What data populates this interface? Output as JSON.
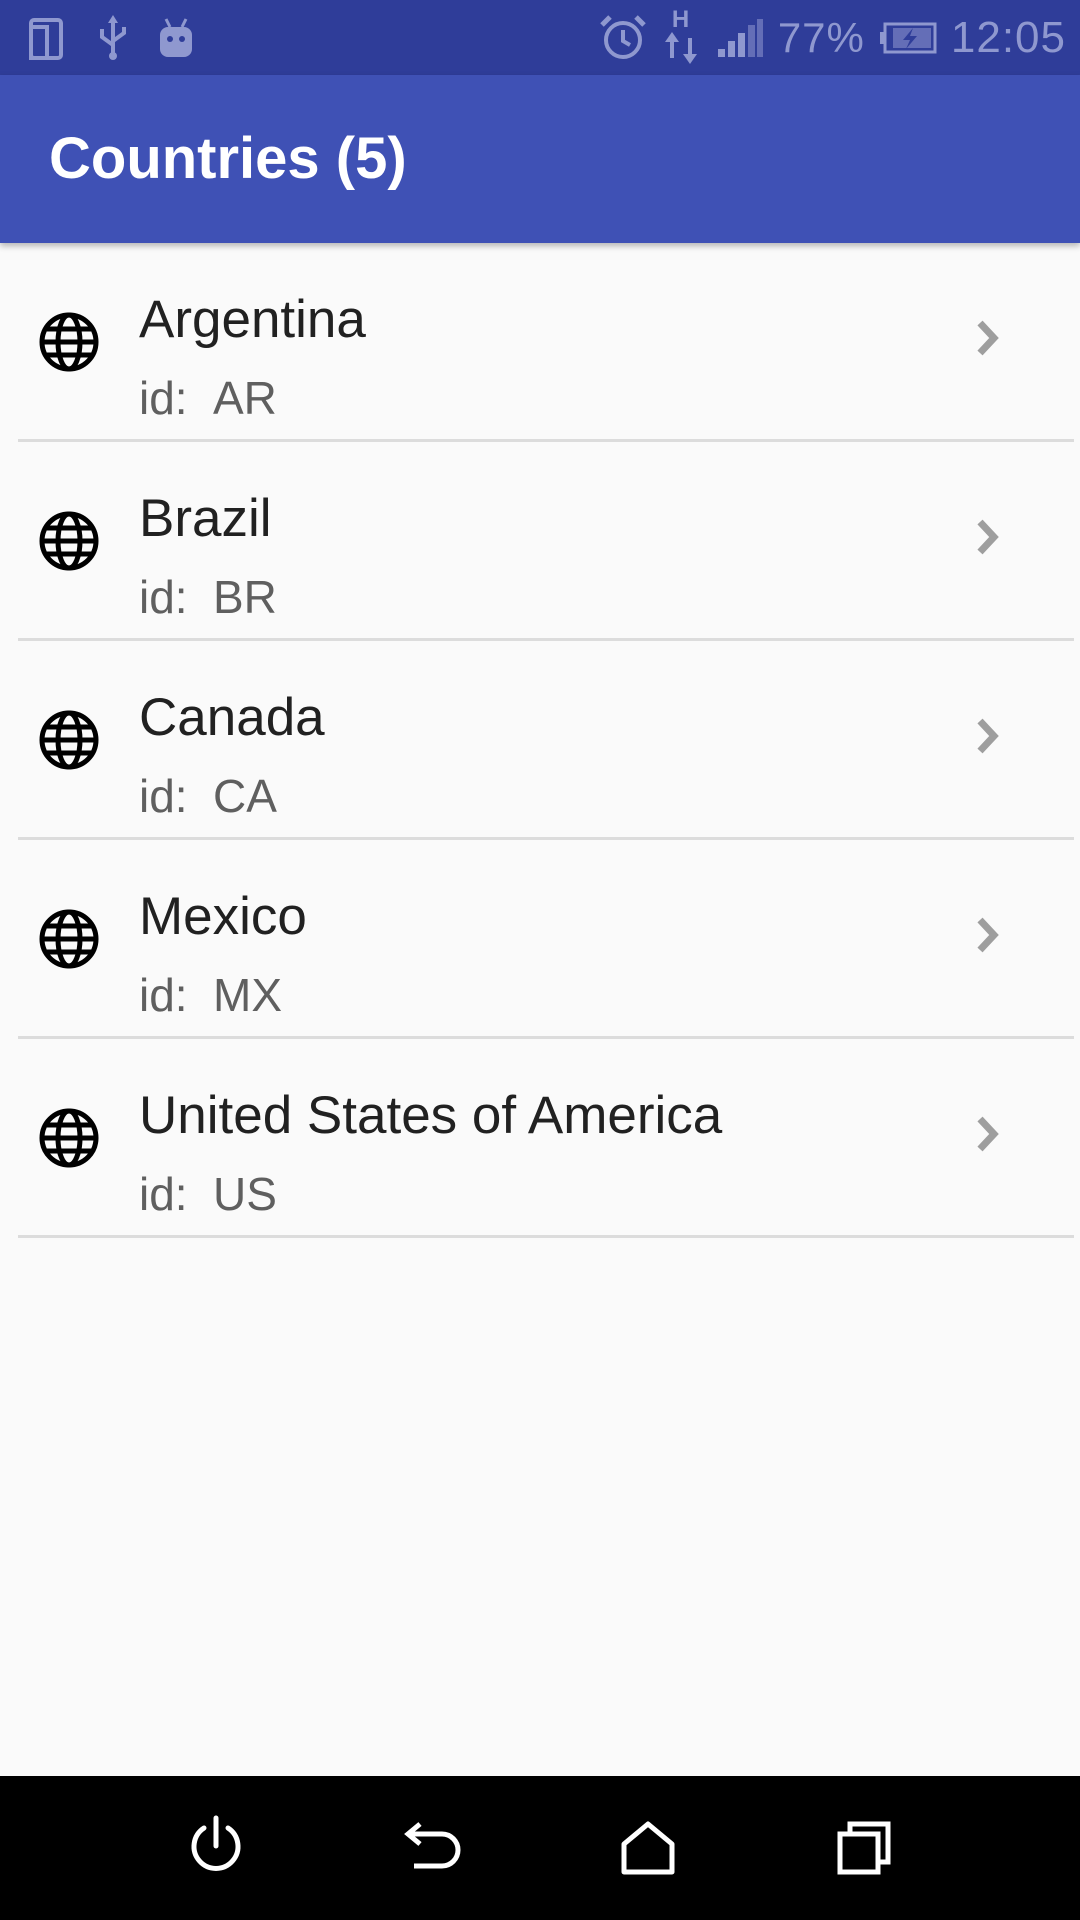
{
  "status_bar": {
    "battery": "77%",
    "time": "12:05",
    "network_type": "H",
    "icons_left": [
      "device-icon",
      "usb-icon",
      "android-debug-icon"
    ],
    "icons_right": [
      "alarm-icon",
      "data-transfer-icon",
      "signal-icon",
      "battery-charging-icon"
    ]
  },
  "app_bar": {
    "title": "Countries (5)"
  },
  "countries": [
    {
      "name": "Argentina",
      "id_label": "id:",
      "id": "AR"
    },
    {
      "name": "Brazil",
      "id_label": "id:",
      "id": "BR"
    },
    {
      "name": "Canada",
      "id_label": "id:",
      "id": "CA"
    },
    {
      "name": "Mexico",
      "id_label": "id:",
      "id": "MX"
    },
    {
      "name": "United States of America",
      "id_label": "id:",
      "id": "US"
    }
  ],
  "nav_bar": {
    "buttons": [
      "power-icon",
      "back-icon",
      "home-icon",
      "recents-icon"
    ]
  },
  "colors": {
    "status_bar": "#2f3d99",
    "app_bar": "#3f51b5",
    "background": "#fafafa",
    "divider": "#dcdcdc",
    "nav_bar": "#000000"
  }
}
